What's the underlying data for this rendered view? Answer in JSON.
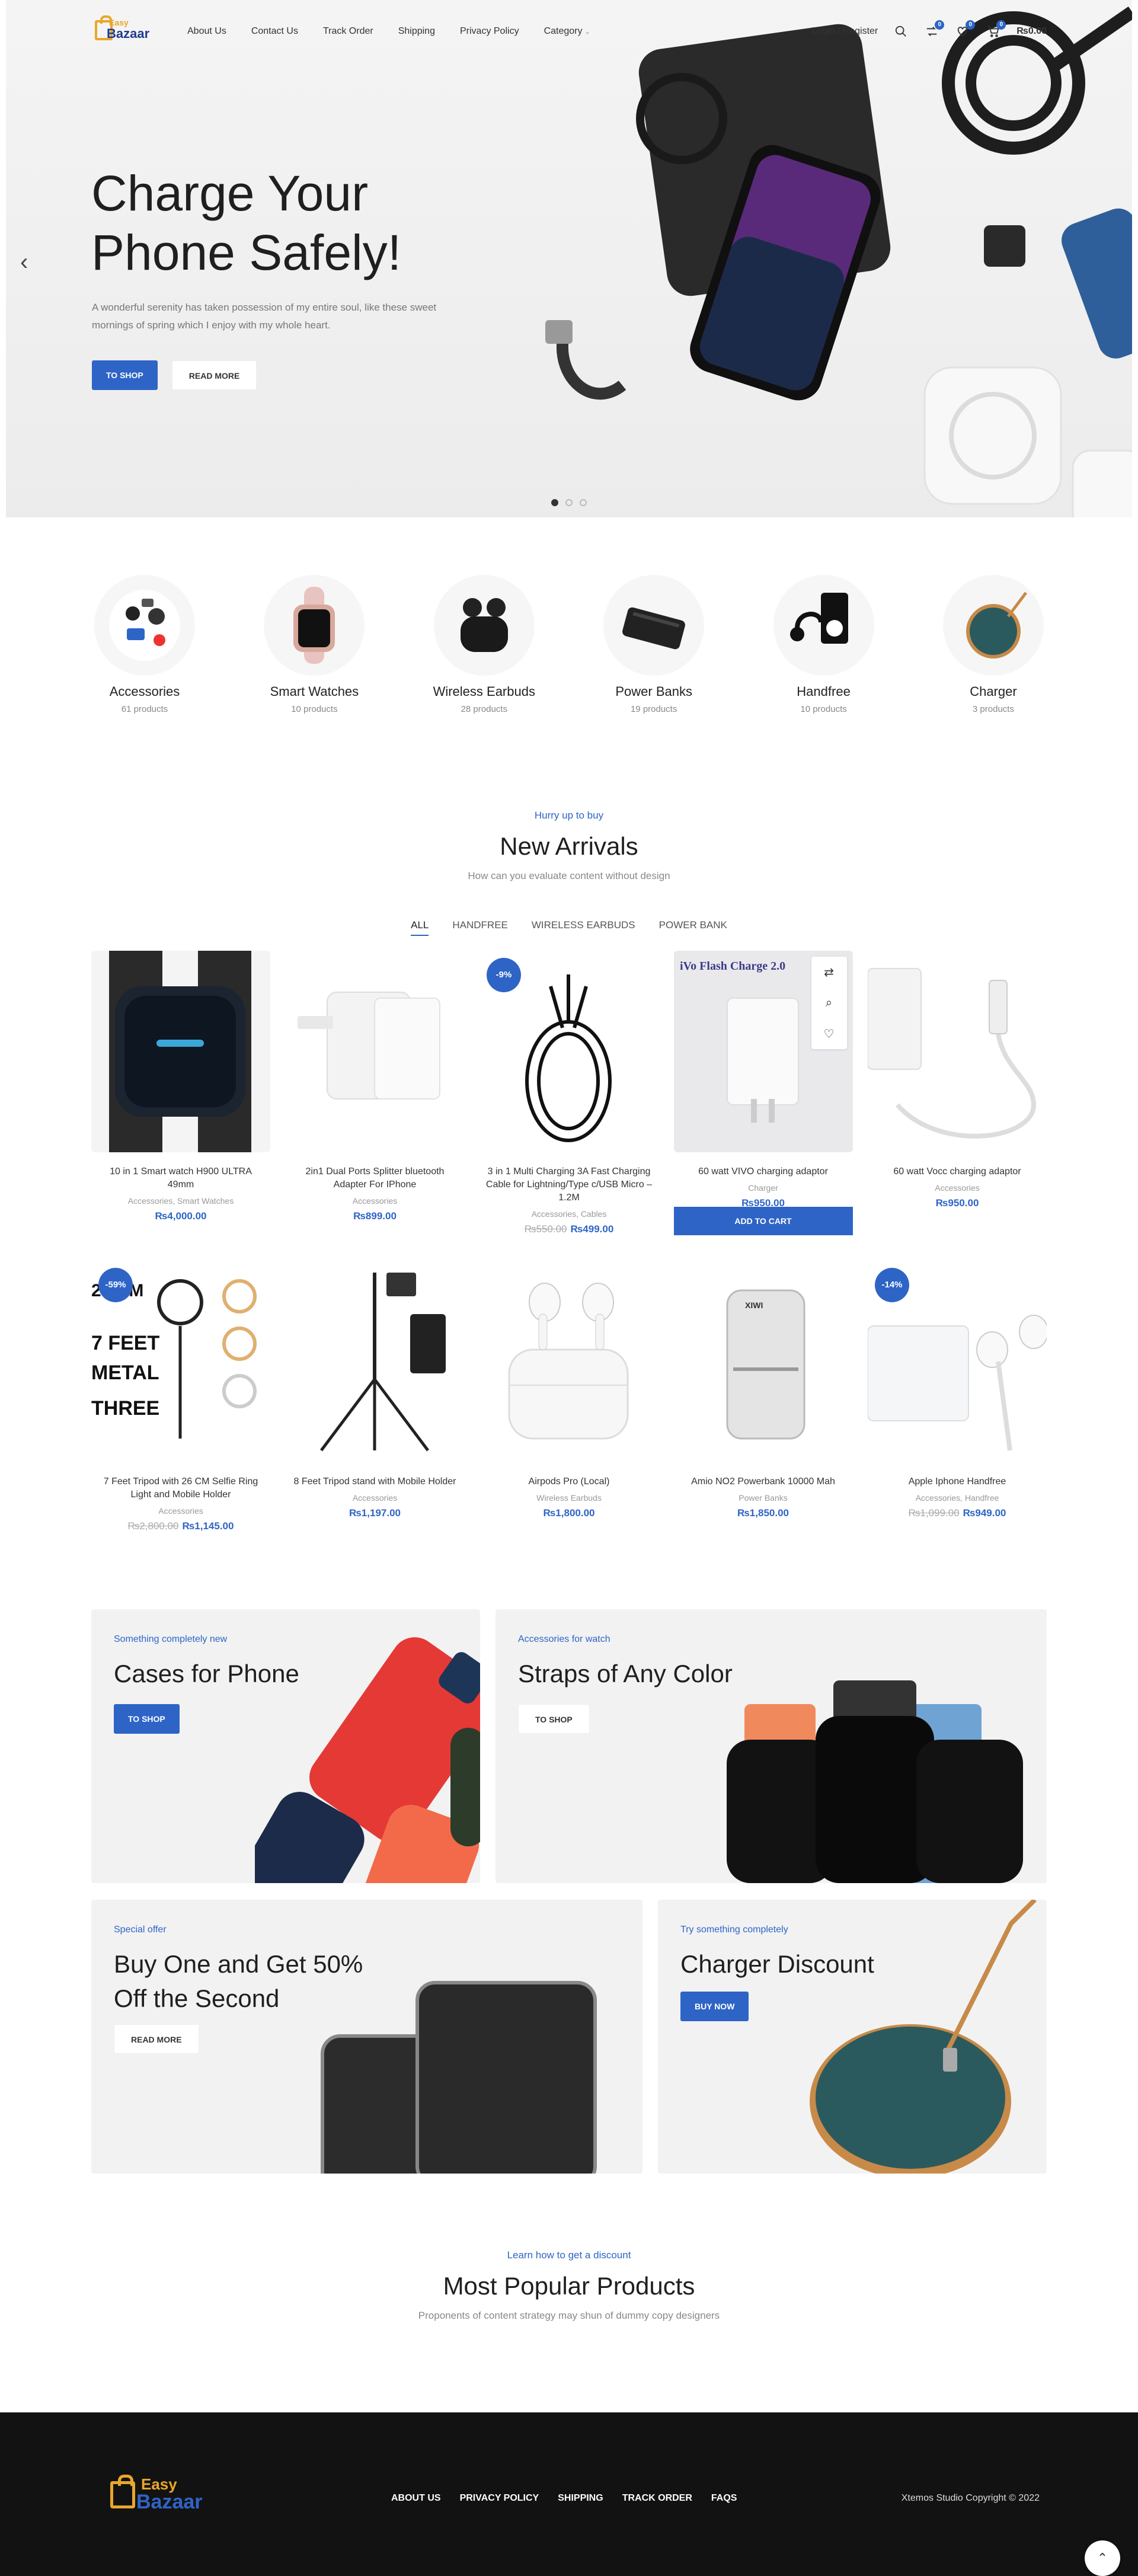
{
  "brand": {
    "line1": "Easy",
    "line2": "Bazaar"
  },
  "nav": [
    "About Us",
    "Contact Us",
    "Track Order",
    "Shipping",
    "Privacy Policy",
    "Category"
  ],
  "header": {
    "login": "Login / Register",
    "compare_count": "0",
    "wishlist_count": "0",
    "cart_count": "0",
    "cart_total": "₨0.00"
  },
  "hero": {
    "title": "Charge Your Phone Safely!",
    "subtitle": "A wonderful serenity has taken possession of my entire soul, like these sweet mornings of spring which I enjoy with my whole heart.",
    "btn_primary": "TO SHOP",
    "btn_secondary": "READ MORE"
  },
  "categories": [
    {
      "name": "Accessories",
      "count": "61 products"
    },
    {
      "name": "Smart Watches",
      "count": "10 products"
    },
    {
      "name": "Wireless Earbuds",
      "count": "28 products"
    },
    {
      "name": "Power Banks",
      "count": "19 products"
    },
    {
      "name": "Handfree",
      "count": "10 products"
    },
    {
      "name": "Charger",
      "count": "3 products"
    }
  ],
  "new_arrivals": {
    "eyebrow": "Hurry up to buy",
    "title": "New Arrivals",
    "subtitle": "How can you evaluate content without design",
    "tabs": [
      "ALL",
      "HANDFREE",
      "WIRELESS EARBUDS",
      "POWER BANK"
    ],
    "add_to_cart": "ADD TO CART"
  },
  "products_row1": [
    {
      "title": "10 in 1 Smart watch H900 ULTRA 49mm",
      "meta": "Accessories, Smart Watches",
      "old": "",
      "price": "₨4,000.00",
      "discount": ""
    },
    {
      "title": "2in1 Dual Ports Splitter bluetooth Adapter For IPhone",
      "meta": "Accessories",
      "old": "",
      "price": "₨899.00",
      "discount": ""
    },
    {
      "title": "3 in 1 Multi Charging 3A Fast Charging Cable for Lightning/Type c/USB Micro – 1.2M",
      "meta": "Accessories, Cables",
      "old": "₨550.00",
      "price": "₨499.00",
      "discount": "-9%"
    },
    {
      "title": "60 watt VIVO charging adaptor",
      "meta": "Charger",
      "old": "",
      "price": "₨950.00",
      "discount": ""
    },
    {
      "title": "60 watt Vocc charging adaptor",
      "meta": "Accessories",
      "old": "",
      "price": "₨950.00",
      "discount": ""
    }
  ],
  "products_row2": [
    {
      "title": "7 Feet Tripod with 26 CM Selfie Ring Light and Mobile Holder",
      "meta": "Accessories",
      "old": "₨2,800.00",
      "price": "₨1,145.00",
      "discount": "-59%"
    },
    {
      "title": "8 Feet Tripod stand with Mobile Holder",
      "meta": "Accessories",
      "old": "",
      "price": "₨1,197.00",
      "discount": ""
    },
    {
      "title": "Airpods Pro (Local)",
      "meta": "Wireless Earbuds",
      "old": "",
      "price": "₨1,800.00",
      "discount": ""
    },
    {
      "title": "Amio NO2 Powerbank 10000 Mah",
      "meta": "Power Banks",
      "old": "",
      "price": "₨1,850.00",
      "discount": ""
    },
    {
      "title": "Apple Iphone Handfree",
      "meta": "Accessories, Handfree",
      "old": "₨1,099.00",
      "price": "₨949.00",
      "discount": "-14%"
    }
  ],
  "promo": {
    "cases": {
      "eyebrow": "Something completely new",
      "title": "Cases for Phone",
      "btn": "TO SHOP"
    },
    "straps": {
      "eyebrow": "Accessories for watch",
      "title": "Straps of Any Color",
      "btn": "TO SHOP"
    },
    "bogo": {
      "eyebrow": "Special offer",
      "title1": "Buy One and Get 50%",
      "title2": "Off the Second",
      "btn": "READ MORE"
    },
    "charger": {
      "eyebrow": "Try something completely",
      "title": "Charger Discount",
      "btn": "BUY NOW"
    }
  },
  "popular": {
    "eyebrow": "Learn how to get a discount",
    "title": "Most Popular Products",
    "subtitle": "Proponents of content strategy may shun of dummy copy designers"
  },
  "footer": {
    "links": [
      "ABOUT US",
      "PRIVACY POLICY",
      "SHIPPING",
      "TRACK ORDER",
      "FAQS"
    ],
    "copyright": "Xtemos Studio Copyright © 2022"
  },
  "colors": {
    "accent": "#2e64c6",
    "brand_gold": "#e9a72a",
    "footer_bg": "#121212"
  }
}
